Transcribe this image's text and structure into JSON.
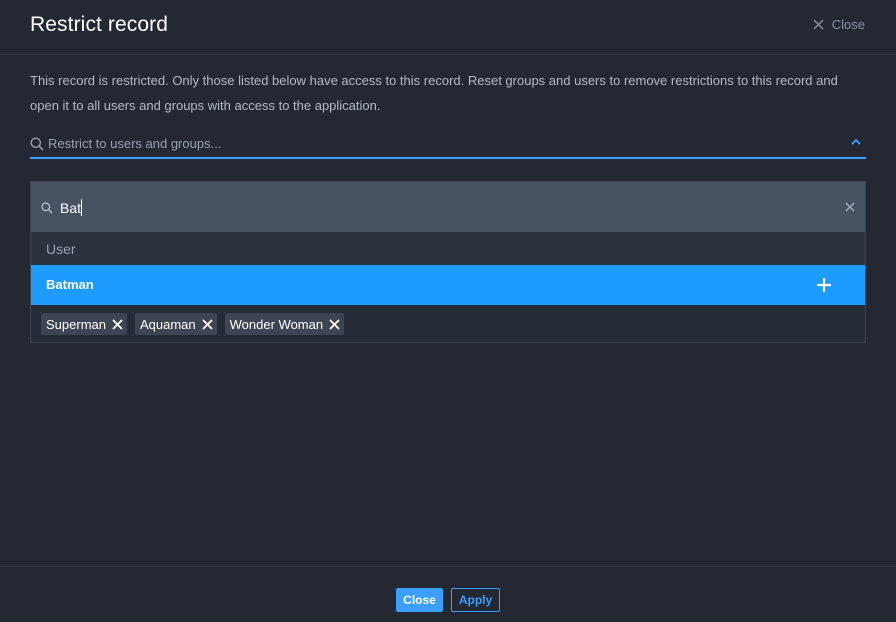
{
  "dialog": {
    "title": "Restrict record",
    "close_label": "Close",
    "description": "This record is restricted. Only those listed below have access to this record. Reset groups and users to remove restrictions to this record and open it to all users and groups with access to the application."
  },
  "search": {
    "placeholder": "Restrict to users and groups..."
  },
  "dropdown": {
    "filter_value": "Bat",
    "group_label": "User",
    "options": [
      {
        "label": "Batman",
        "highlighted": true
      }
    ]
  },
  "selected": [
    {
      "label": "Superman"
    },
    {
      "label": "Aquaman"
    },
    {
      "label": "Wonder Woman"
    }
  ],
  "footer": {
    "close_label": "Close",
    "apply_label": "Apply"
  },
  "colors": {
    "background": "#232833",
    "accent": "#3a9fff",
    "highlight": "#1e9bff",
    "chip": "#3d4553",
    "filter_box": "#485263"
  },
  "icons": {
    "close": "close-icon",
    "search": "search-icon",
    "chevron": "chevron-up-icon",
    "clear": "clear-icon",
    "add": "plus-icon",
    "remove": "remove-icon"
  }
}
